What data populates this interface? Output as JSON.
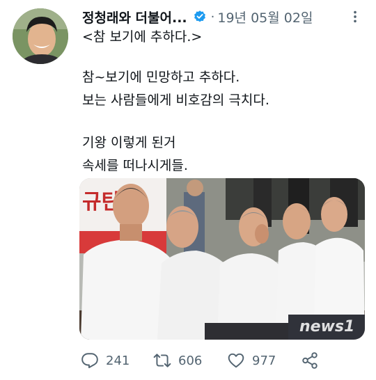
{
  "author": {
    "display_name": "정청래와 더불어...",
    "verified": true,
    "avatar": "profile-photo"
  },
  "meta": {
    "separator": "·",
    "date": "19년 05월 02일"
  },
  "tweet": {
    "line1": "<참 보기에 추하다.>",
    "line2": "참~보기에 민망하고 추하다.",
    "line3": "보는 사람들에게 비호감의 극치다.",
    "line4": "기왕 이렇게 된거",
    "line5": "속세를 떠나시게들."
  },
  "media": {
    "banner_text": "규탄",
    "watermark": "news1"
  },
  "actions": {
    "reply_count": "241",
    "retweet_count": "606",
    "like_count": "977"
  },
  "colors": {
    "text": "#0f1419",
    "secondary": "#536471",
    "verified_badge": "#1d9bf0"
  },
  "icons": [
    "more-icon",
    "verified-icon",
    "reply-icon",
    "retweet-icon",
    "like-icon",
    "share-icon"
  ]
}
